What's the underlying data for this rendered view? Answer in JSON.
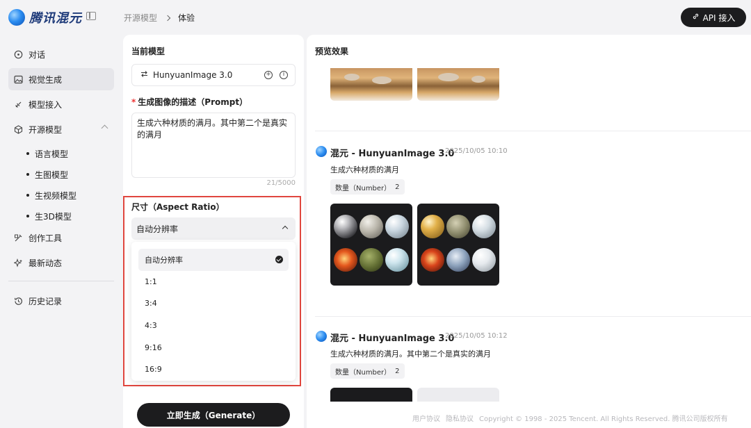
{
  "brand": {
    "name": "腾讯混元"
  },
  "breadcrumb": {
    "parent": "开源模型",
    "current": "体验"
  },
  "header": {
    "api_button": "API 接入"
  },
  "sidebar": {
    "items": [
      {
        "label": "对话",
        "icon": "chat-icon"
      },
      {
        "label": "视觉生成",
        "icon": "image-icon",
        "active": true
      },
      {
        "label": "模型接入",
        "icon": "plug-icon"
      },
      {
        "label": "开源模型",
        "icon": "cube-icon",
        "expanded": true
      },
      {
        "label": "创作工具",
        "icon": "wand-icon"
      },
      {
        "label": "最新动态",
        "icon": "sparkle-icon"
      }
    ],
    "sub_items": [
      "语言模型",
      "生图模型",
      "生视频模型",
      "生3D模型"
    ],
    "history": "历史记录"
  },
  "left_panel": {
    "current_model_title": "当前模型",
    "model_name": "HunyuanImage 3.0",
    "prompt_label": "生成图像的描述（Prompt）",
    "prompt_value": "生成六种材质的满月。其中第二个是真实的满月",
    "prompt_count": "21/5000",
    "aspect_label": "尺寸（Aspect Ratio）",
    "aspect_selected": "自动分辨率",
    "aspect_options": [
      "自动分辨率",
      "1:1",
      "3:4",
      "4:3",
      "9:16",
      "16:9"
    ],
    "generate_button": "立即生成（Generate）"
  },
  "right_panel": {
    "title": "预览效果",
    "entries": [
      {
        "title": "混元 - HunyuanImage 3.0",
        "time": "2025/10/05 10:10",
        "prompt": "生成六种材质的满月",
        "tag_label": "数量（Number）",
        "tag_value": "2"
      },
      {
        "title": "混元 - HunyuanImage 3.0",
        "time": "2025/10/05 10:12",
        "prompt": "生成六种材质的满月。其中第二个是真实的满月",
        "tag_label": "数量（Number）",
        "tag_value": "2"
      }
    ]
  },
  "footer": {
    "links": [
      "用户协议",
      "隐私协议"
    ],
    "copyright": "Copyright © 1998 - 2025 Tencent. All Rights Reserved. 腾讯公司版权所有"
  },
  "colors": {
    "accent_dark": "#1c1c1e",
    "highlight_border": "#e0463e"
  }
}
